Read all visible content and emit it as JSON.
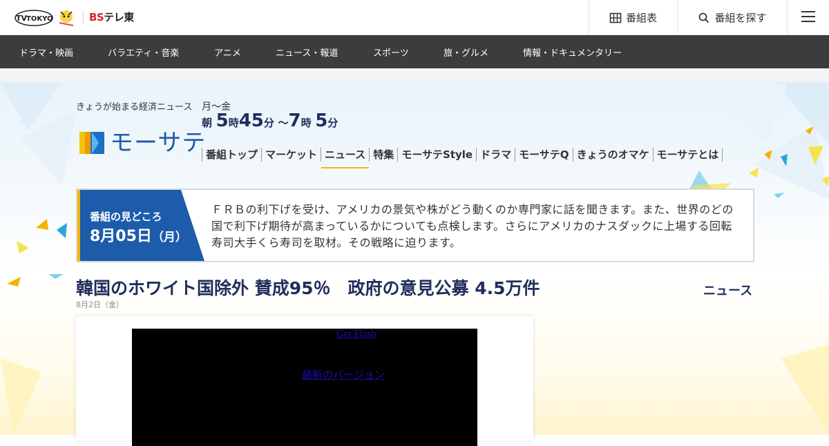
{
  "header": {
    "tvtokyo_logo": "TV TOKYO",
    "bs_logo_bs": "BS",
    "bs_logo_rest": "テレ東",
    "bangumi_label": "番組表",
    "search_label": "番組を探す"
  },
  "genre_nav": [
    "ドラマ・映画",
    "バラエティ・音楽",
    "アニメ",
    "ニュース・報道",
    "スポーツ",
    "旅・グルメ",
    "情報・ドキュメンタリー"
  ],
  "program": {
    "tagline": "きょうが始まる経済ニュース",
    "logo_text": "モーサテ",
    "days": "月～金",
    "time_prefix": "朝",
    "start_hour": "5",
    "hour_unit": "時",
    "start_min": "45",
    "min_unit": "分",
    "separator": "～",
    "end_hour": "7",
    "end_min": "5",
    "nav": [
      "番組トップ",
      "マーケット",
      "ニュース",
      "特集",
      "モーサテStyle",
      "ドラマ",
      "モーサテQ",
      "きょうのオマケ",
      "モーサテとは"
    ],
    "active_nav": "ニュース"
  },
  "highlight": {
    "label": "番組の見どころ",
    "date_num": "8月05日",
    "date_day": "（月）",
    "text": "ＦＲＢの利下げを受け、アメリカの景気や株がどう動くのか専門家に話を聞きます。また、世界のどの国で利下げ期待が高まっているかについても点検します。さらにアメリカのナスダックに上場する回転寿司大手くら寿司を取材。その戦略に迫ります。"
  },
  "article": {
    "title": "韓国のホワイト国除外 賛成95％　政府の意見公募 4.5万件",
    "category": "ニュース",
    "date": "8月2日（金）",
    "flash_link": "Get Flash",
    "version_link": "最新のバージョン"
  },
  "colors": {
    "nav_bg": "#3c3c3c",
    "brand_blue": "#1c5cab",
    "title_navy": "#1e2e5c",
    "accent_yellow": "#f4b400",
    "bs_red": "#d8232a"
  }
}
